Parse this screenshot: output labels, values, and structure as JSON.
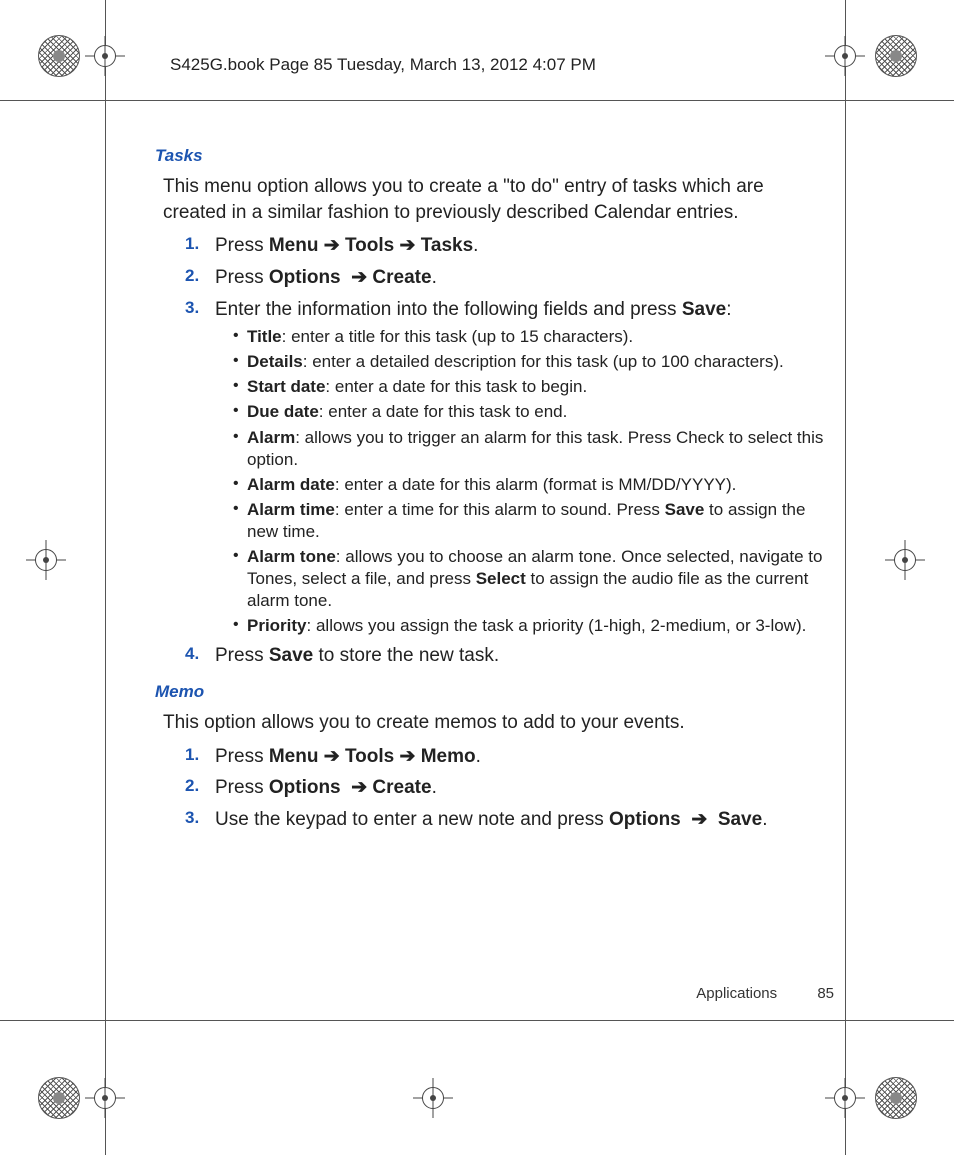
{
  "header": "S425G.book  Page 85  Tuesday, March 13, 2012  4:07 PM",
  "footer": {
    "section": "Applications",
    "page": "85"
  },
  "arrow": "➔",
  "tasks": {
    "heading": "Tasks",
    "intro": "This menu option allows you to create a \"to do\" entry of tasks which are created in a similar fashion to previously described Calendar entries.",
    "steps": {
      "s1": {
        "n": "1.",
        "press": "Press ",
        "menu": "Menu",
        "tools": "Tools",
        "dest": "Tasks",
        "end": "."
      },
      "s2": {
        "n": "2.",
        "press": "Press ",
        "opt": "Options",
        "create": "Create",
        "end": "."
      },
      "s3": {
        "n": "3.",
        "text_a": "Enter the information into the following fields and press ",
        "save": "Save",
        "end": ":"
      },
      "s4": {
        "n": "4.",
        "press": "Press ",
        "save": "Save",
        "rest": " to store the new task."
      }
    },
    "fields": {
      "title": {
        "label": "Title",
        "text": ": enter a title for this task (up to 15 characters)."
      },
      "details": {
        "label": "Details",
        "text": ": enter a detailed description for this task (up to 100 characters)."
      },
      "startdate": {
        "label": "Start date",
        "text": ": enter a date for this task to begin."
      },
      "duedate": {
        "label": "Due date",
        "text": ": enter a date for this task to end."
      },
      "alarm": {
        "label": "Alarm",
        "text": ": allows you to trigger an alarm for this task. Press Check to select this option."
      },
      "alarmdate": {
        "label": "Alarm date",
        "text": ": enter a date for this alarm (format is MM/DD/YYYY)."
      },
      "alarmtime": {
        "label": "Alarm time",
        "text_a": ": enter a time for this alarm to sound. Press ",
        "save": "Save",
        "text_b": " to assign the new time."
      },
      "alarmtone": {
        "label": "Alarm tone",
        "text_a": ": allows you to choose an alarm tone. Once selected, navigate to Tones, select a file, and press ",
        "select": "Select",
        "text_b": " to assign the audio file as the current alarm tone."
      },
      "priority": {
        "label": "Priority",
        "text": ": allows you assign the task a priority (1-high, 2-medium, or 3-low)."
      }
    }
  },
  "memo": {
    "heading": "Memo",
    "intro": "This option allows you to create memos to add to your events.",
    "steps": {
      "s1": {
        "n": "1.",
        "press": "Press ",
        "menu": "Menu",
        "tools": "Tools",
        "dest": "Memo",
        "end": "."
      },
      "s2": {
        "n": "2.",
        "press": "Press ",
        "opt": "Options",
        "create": "Create",
        "end": "."
      },
      "s3": {
        "n": "3.",
        "text_a": "Use the keypad to enter a new note and press ",
        "opt": "Options",
        "save": "Save",
        "end": "."
      }
    }
  }
}
